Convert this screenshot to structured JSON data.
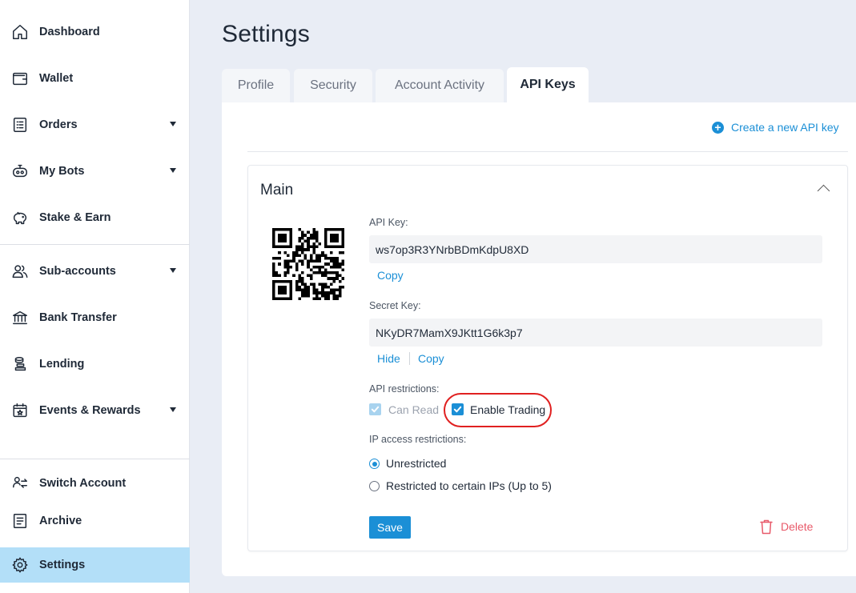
{
  "sidebar": {
    "items": [
      {
        "label": "Dashboard",
        "icon": "home-icon"
      },
      {
        "label": "Wallet",
        "icon": "wallet-icon"
      },
      {
        "label": "Orders",
        "icon": "orders-list-icon"
      },
      {
        "label": "My Bots",
        "icon": "robot-icon"
      },
      {
        "label": "Stake & Earn",
        "icon": "piggy-bank-icon"
      },
      {
        "label": "Sub-accounts",
        "icon": "users-icon"
      },
      {
        "label": "Bank Transfer",
        "icon": "bank-icon"
      },
      {
        "label": "Lending",
        "icon": "coins-icon"
      },
      {
        "label": "Events & Rewards",
        "icon": "calendar-star-icon"
      },
      {
        "label": "Switch Account",
        "icon": "switch-account-icon"
      },
      {
        "label": "Archive",
        "icon": "archive-icon"
      },
      {
        "label": "Settings",
        "icon": "gear-icon"
      }
    ]
  },
  "page": {
    "title": "Settings"
  },
  "tabs": [
    {
      "label": "Profile",
      "active": false
    },
    {
      "label": "Security",
      "active": false
    },
    {
      "label": "Account Activity",
      "active": false
    },
    {
      "label": "API Keys",
      "active": true
    }
  ],
  "api_keys": {
    "create_label": "Create a new API key",
    "card": {
      "title": "Main",
      "api_key_label": "API Key:",
      "api_key_value": "ws7op3R3YNrbBDmKdpU8XD",
      "api_copy_label": "Copy",
      "secret_key_label": "Secret Key:",
      "secret_key_value": "NKyDR7MamX9JKtt1G6k3p7",
      "secret_hide_label": "Hide",
      "secret_copy_label": "Copy",
      "restrictions_label": "API restrictions:",
      "can_read_label": "Can Read",
      "enable_trading_label": "Enable Trading",
      "ip_label": "IP access restrictions:",
      "ip_options": [
        {
          "label": "Unrestricted",
          "selected": true
        },
        {
          "label": "Restricted to certain IPs (Up to 5)",
          "selected": false
        }
      ],
      "save_label": "Save",
      "delete_label": "Delete"
    }
  },
  "colors": {
    "accent": "#1b8fd6",
    "active_nav": "#b3dff8",
    "danger": "#e85a6a",
    "highlight": "#e02020"
  }
}
